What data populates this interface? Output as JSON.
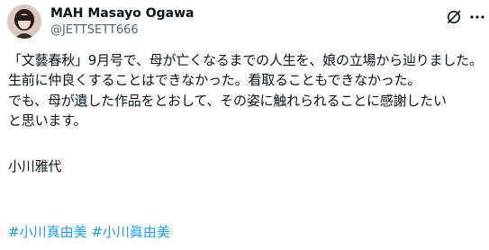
{
  "author": {
    "display_name": "MAH Masayo Ogawa",
    "handle": "@JETTSETT666"
  },
  "icons": {
    "avatar": "profile-photo",
    "grok": "grok-icon",
    "more": "more-options-icon"
  },
  "post": {
    "lines": [
      "「文藝春秋」9月号で、母が亡くなるまでの人生を、娘の立場から辿りました。",
      "生前に仲良くすることはできなかった。看取ることもできなかった。",
      "でも、母が遺した作品をとおして、その姿に触れられることに感謝したい",
      "と思います。"
    ],
    "signature": "小川雅代",
    "hashtags": [
      "#小川真由美",
      "#小川眞由美"
    ]
  },
  "colors": {
    "text": "#0f1419",
    "secondary": "#536471",
    "link": "#1d9bf0"
  }
}
